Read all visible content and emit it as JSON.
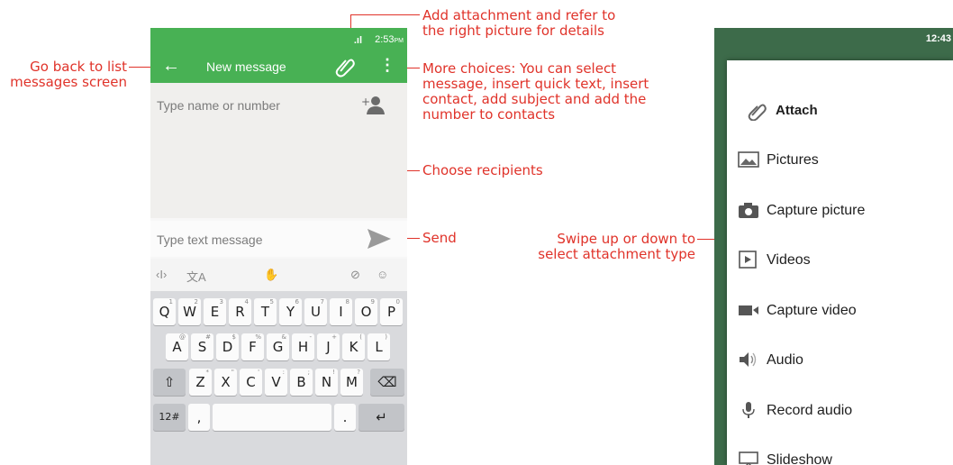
{
  "annotations": {
    "back": "Go back to list\nmessages screen",
    "attach": "Add attachment and refer to\nthe right picture for details",
    "more": "More choices: You can select\nmessage, insert quick text, insert\ncontact, add subject and add the\nnumber to contacts",
    "recipients": "Choose recipients",
    "send": "Send",
    "swipe": "Swipe up or down to\nselect attachment type"
  },
  "phone1": {
    "status_signal": ".ıl",
    "status_time": "2:53",
    "status_ampm": "PM",
    "title": "New message",
    "recipient_placeholder": "Type name or number",
    "text_placeholder": "Type text message",
    "toolbar_icons": [
      "cursor-icon",
      "translate-icon",
      "gesture-icon",
      "hide-icon",
      "emoji-icon"
    ],
    "keyboard": {
      "row1": [
        [
          "Q",
          "1"
        ],
        [
          "W",
          "2"
        ],
        [
          "E",
          "3"
        ],
        [
          "R",
          "4"
        ],
        [
          "T",
          "5"
        ],
        [
          "Y",
          "6"
        ],
        [
          "U",
          "7"
        ],
        [
          "I",
          "8"
        ],
        [
          "O",
          "9"
        ],
        [
          "P",
          "0"
        ]
      ],
      "row2": [
        [
          "A",
          "@"
        ],
        [
          "S",
          "#"
        ],
        [
          "D",
          "$"
        ],
        [
          "F",
          "%"
        ],
        [
          "G",
          "&"
        ],
        [
          "H",
          "-"
        ],
        [
          "J",
          "+"
        ],
        [
          "K",
          "("
        ],
        [
          "L",
          ")"
        ]
      ],
      "row3": [
        [
          "Z",
          "*"
        ],
        [
          "X",
          "\""
        ],
        [
          "C",
          "'"
        ],
        [
          "V",
          ":"
        ],
        [
          "B",
          ";"
        ],
        [
          "N",
          "!"
        ],
        [
          "M",
          "?"
        ]
      ],
      "num_label": "12#",
      "comma_label": ",",
      "period_label": ".",
      "shift_icon": "shift-icon",
      "backspace_icon": "backspace-icon",
      "enter_icon": "enter-icon"
    }
  },
  "phone2": {
    "status_time": "12:43",
    "menu_title": "Attach",
    "items": [
      {
        "label": "Pictures",
        "icon": "picture-icon"
      },
      {
        "label": "Capture picture",
        "icon": "camera-icon"
      },
      {
        "label": "Videos",
        "icon": "video-icon"
      },
      {
        "label": "Capture video",
        "icon": "videocam-icon"
      },
      {
        "label": "Audio",
        "icon": "speaker-icon"
      },
      {
        "label": "Record audio",
        "icon": "mic-icon"
      },
      {
        "label": "Slideshow",
        "icon": "slideshow-icon"
      }
    ]
  },
  "colors": {
    "accent_green": "#48b154",
    "annotation_red": "#e0332a"
  }
}
